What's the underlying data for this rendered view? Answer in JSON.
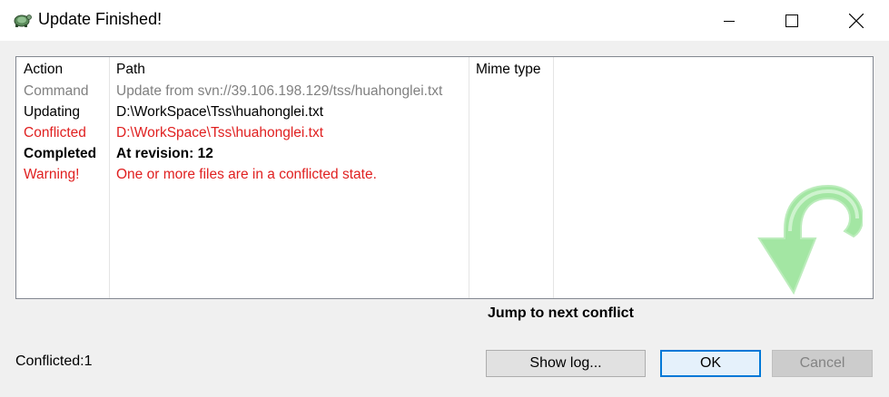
{
  "window": {
    "title": "Update Finished!",
    "app_icon": "tortoisesvn-turtle-icon",
    "controls": [
      "minimize-icon",
      "maximize-icon",
      "close-icon"
    ]
  },
  "list": {
    "headers": {
      "action": "Action",
      "path": "Path",
      "mime": "Mime type"
    },
    "rows": [
      {
        "action": "Command",
        "path": "Update from svn://39.106.198.129/tss/huahonglei.txt",
        "style": "gray"
      },
      {
        "action": "Updating",
        "path": "D:\\WorkSpace\\Tss\\huahonglei.txt",
        "style": "black"
      },
      {
        "action": "Conflicted",
        "path": "D:\\WorkSpace\\Tss\\huahonglei.txt",
        "style": "red"
      },
      {
        "action": "Completed",
        "path": "At revision: 12",
        "style": "bold"
      },
      {
        "action": "Warning!",
        "path": "One or more files are in a conflicted state.",
        "style": "red"
      }
    ],
    "watermark_icon": "update-arrow-icon"
  },
  "jump_link": "Jump to next conflict",
  "status_text": "Conflicted:1",
  "buttons": {
    "show_log": "Show log...",
    "ok": "OK",
    "cancel": "Cancel"
  },
  "colors": {
    "conflict_red": "#e02020",
    "command_gray": "#808080",
    "ok_focus_blue": "#0078d7",
    "arrow_green": "#8de08d"
  }
}
